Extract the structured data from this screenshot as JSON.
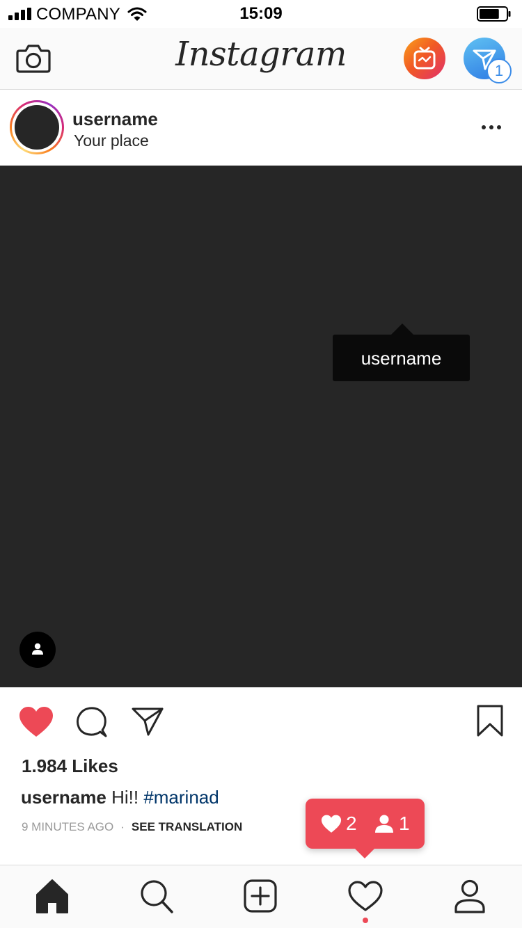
{
  "status_bar": {
    "carrier": "COMPANY",
    "time": "15:09",
    "signal_bars": 4,
    "wifi_icon": "wifi-icon",
    "battery_level": 0.75
  },
  "header": {
    "logo_text": "Instagram",
    "camera_icon": "camera-icon",
    "igtv_icon": "igtv-icon",
    "direct_icon": "direct-message-icon",
    "direct_badge": "1",
    "igtv_gradient": [
      "#f9a01b",
      "#e1306c"
    ],
    "direct_color": "#2e7be4"
  },
  "post": {
    "username": "username",
    "location": "Your place",
    "more_icon": "more-options-icon",
    "tag_label": "username",
    "tagged_icon": "user-tag-icon",
    "liked": true,
    "like_color": "#ed4956",
    "likes_text": "1.984 Likes",
    "caption_username": "username",
    "caption_text": "Hi!!",
    "caption_hashtag": "#marinad",
    "time_ago": "9 MINUTES AGO",
    "separator": "·",
    "translate_label": "SEE TRANSLATION"
  },
  "activity_popup": {
    "likes_count": "2",
    "followers_count": "1",
    "heart_icon": "heart-icon",
    "person_icon": "person-icon"
  },
  "tab_bar": {
    "items": [
      "home-icon",
      "search-icon",
      "add-post-icon",
      "activity-icon",
      "profile-icon"
    ],
    "active": "home",
    "activity_has_dot": true
  }
}
